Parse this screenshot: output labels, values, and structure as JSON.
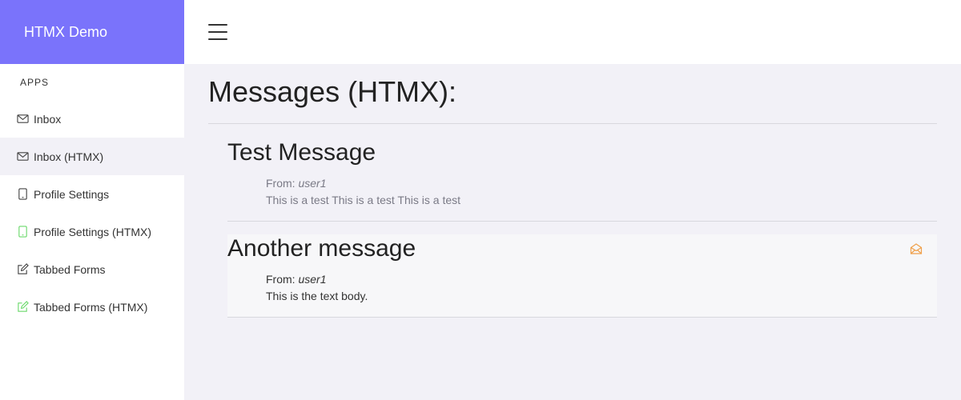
{
  "brand": {
    "title": "HTMX Demo",
    "color": "#7a73fb"
  },
  "sidebar": {
    "section_label": "APPS",
    "items": [
      {
        "label": "Inbox",
        "icon": "envelope-icon"
      },
      {
        "label": "Inbox (HTMX)",
        "icon": "envelope-icon",
        "active": true
      },
      {
        "label": "Profile Settings",
        "icon": "tablet-icon"
      },
      {
        "label": "Profile Settings (HTMX)",
        "icon": "tablet-icon",
        "icon_color": "#6bd96b"
      },
      {
        "label": "Tabbed Forms",
        "icon": "edit-icon"
      },
      {
        "label": "Tabbed Forms (HTMX)",
        "icon": "edit-icon",
        "icon_color": "#6bd96b"
      }
    ]
  },
  "topbar": {
    "menu_icon": "hamburger-icon"
  },
  "main": {
    "title": "Messages (HTMX):",
    "messages": [
      {
        "title": "Test Message",
        "from_label": "From:",
        "from_user": "user1",
        "body": "This is a test This is a test This is a test",
        "state": "read"
      },
      {
        "title": "Another message",
        "from_label": "From:",
        "from_user": "user1",
        "body": "This is the text body.",
        "state": "unread",
        "action_icon": "mail-open-icon",
        "action_icon_color": "#f0a04b"
      }
    ]
  }
}
